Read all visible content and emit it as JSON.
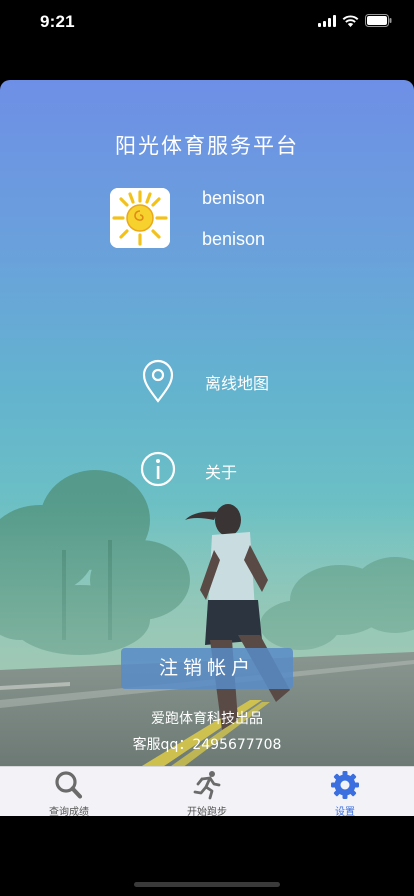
{
  "status_bar": {
    "time": "9:21"
  },
  "header": {
    "title": "阳光体育服务平台"
  },
  "user": {
    "name": "benison",
    "account": "benison"
  },
  "menu": [
    {
      "label": "离线地图",
      "icon": "map-pin-icon"
    },
    {
      "label": "关于",
      "icon": "info-icon"
    }
  ],
  "logout_button": {
    "label": "注销帐户"
  },
  "footer": {
    "credit": "爱跑体育科技出品",
    "service": "客服qq：2495677708"
  },
  "tabs": [
    {
      "label": "查询成绩",
      "icon": "search-icon",
      "active": false
    },
    {
      "label": "开始跑步",
      "icon": "runner-icon",
      "active": false
    },
    {
      "label": "设置",
      "icon": "gear-icon",
      "active": true
    }
  ],
  "colors": {
    "accent": "#3b6fe0",
    "button": "#588cc8"
  }
}
